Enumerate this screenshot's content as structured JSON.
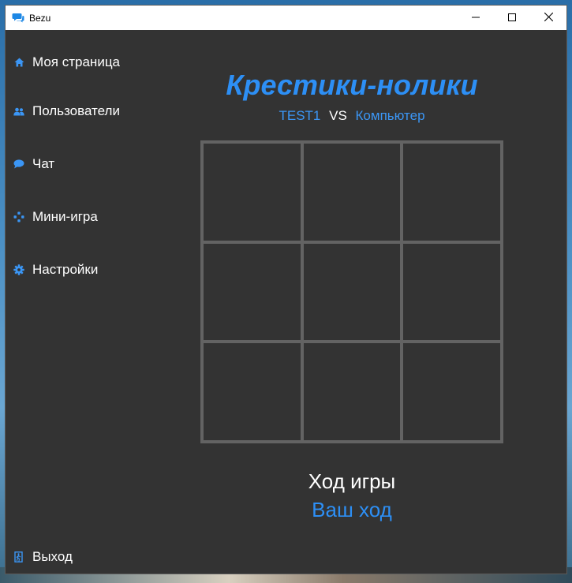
{
  "window": {
    "title": "Bezu",
    "icon": "chat-bubbles-icon",
    "controls": [
      "minimize-icon",
      "maximize-icon",
      "close-icon"
    ]
  },
  "sidebar": {
    "items": [
      {
        "label": "Моя страница",
        "icon": "home-icon"
      },
      {
        "label": "Пользователи",
        "icon": "users-icon"
      },
      {
        "label": "Чат",
        "icon": "chat-icon"
      },
      {
        "label": "Мини-игра",
        "icon": "gamepad-icon"
      },
      {
        "label": "Настройки",
        "icon": "gear-icon"
      }
    ],
    "logout": {
      "label": "Выход",
      "icon": "exit-icon"
    }
  },
  "game": {
    "title": "Крестики-нолики",
    "player1": "TEST1",
    "vs": "VS",
    "player2": "Компьютер",
    "board": [
      "",
      "",
      "",
      "",
      "",
      "",
      "",
      "",
      ""
    ],
    "status_label": "Ход игры",
    "status_value": "Ваш ход"
  },
  "colors": {
    "accent": "#2d8ff5",
    "background": "#333333",
    "grid": "#636363",
    "text": "#ffffff"
  }
}
